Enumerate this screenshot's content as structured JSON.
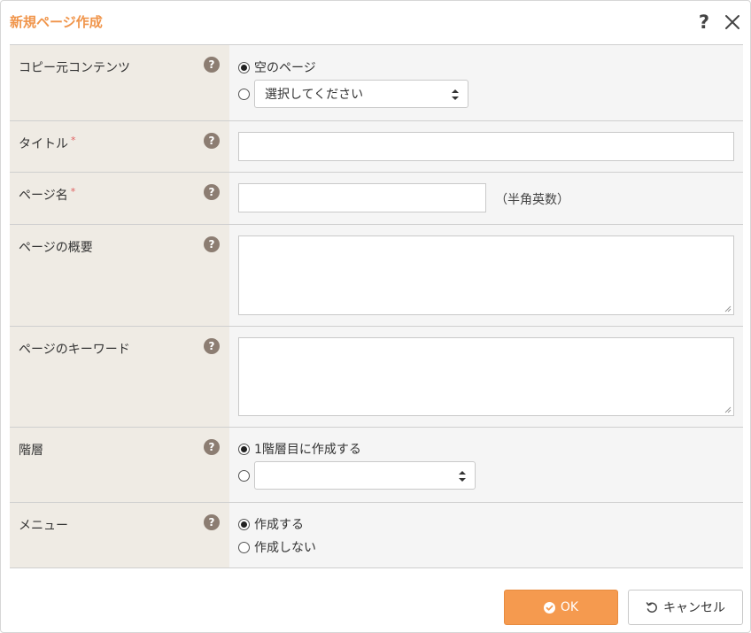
{
  "dialog": {
    "title": "新規ページ作成",
    "help_icon": "?",
    "accent_color": "#f0954b"
  },
  "form": {
    "rows": [
      {
        "label": "コピー元コンテンツ",
        "options": [
          {
            "label": "空のページ",
            "checked": true
          },
          {
            "select_value": "選択してください",
            "checked": false
          }
        ]
      },
      {
        "label": "タイトル",
        "required_mark": "*",
        "value": ""
      },
      {
        "label": "ページ名",
        "required_mark": "*",
        "value": "",
        "note": "（半角英数）"
      },
      {
        "label": "ページの概要",
        "value": ""
      },
      {
        "label": "ページのキーワード",
        "value": ""
      },
      {
        "label": "階層",
        "options": [
          {
            "label": "1階層目に作成する",
            "checked": true
          },
          {
            "select_value": "",
            "checked": false
          }
        ]
      },
      {
        "label": "メニュー",
        "options": [
          {
            "label": "作成する",
            "checked": true
          },
          {
            "label": "作成しない",
            "checked": false
          }
        ]
      }
    ],
    "help_badge": "?"
  },
  "buttons": {
    "ok_label": "OK",
    "cancel_label": "キャンセル",
    "ok_color": "#f59a4f"
  }
}
